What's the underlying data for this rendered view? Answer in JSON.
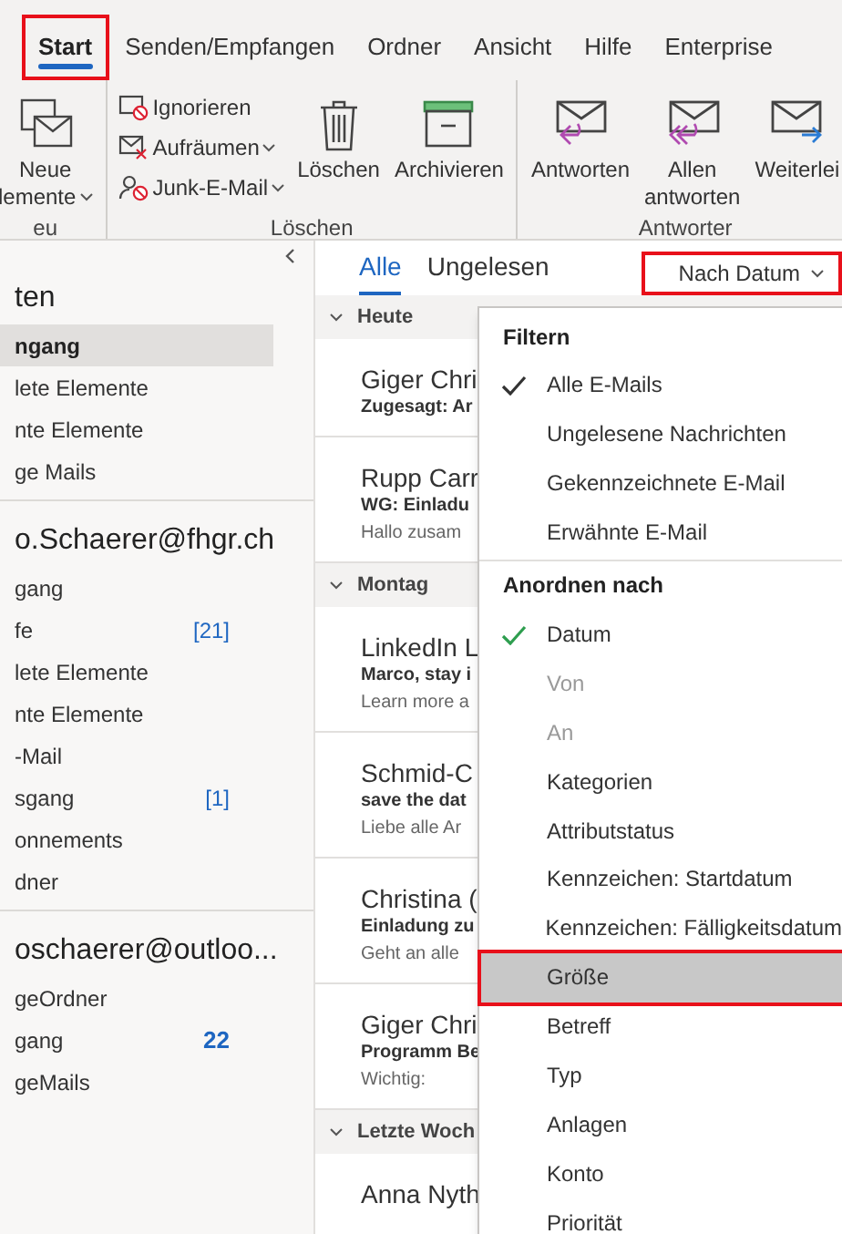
{
  "ribbon": {
    "tabs": [
      {
        "label": "Start",
        "selected": true,
        "annotated": true
      },
      {
        "label": "Senden/Empfangen",
        "selected": false,
        "annotated": false
      },
      {
        "label": "Ordner",
        "selected": false,
        "annotated": false
      },
      {
        "label": "Ansicht",
        "selected": false,
        "annotated": false
      },
      {
        "label": "Hilfe",
        "selected": false,
        "annotated": false
      },
      {
        "label": "Enterprise",
        "selected": false,
        "annotated": false
      }
    ],
    "groups": [
      {
        "label": "eu",
        "buttons": [
          {
            "kind": "large",
            "lines": [
              "Neue",
              "lemente"
            ],
            "caret": true
          }
        ]
      },
      {
        "label": "Löschen",
        "buttons": [
          {
            "kind": "small",
            "lines": [
              "Ignorieren"
            ],
            "caret": false
          },
          {
            "kind": "small",
            "lines": [
              "Aufräumen"
            ],
            "caret": true
          },
          {
            "kind": "small",
            "lines": [
              "Junk-E-Mail"
            ],
            "caret": true
          },
          {
            "kind": "large",
            "lines": [
              "Löschen"
            ],
            "caret": false
          },
          {
            "kind": "large",
            "lines": [
              "Archivieren"
            ],
            "caret": false
          }
        ]
      },
      {
        "label": "Antworter",
        "buttons": [
          {
            "kind": "large",
            "lines": [
              "Antworten"
            ],
            "caret": false
          },
          {
            "kind": "large",
            "lines": [
              "Allen",
              "antworten"
            ],
            "caret": false
          },
          {
            "kind": "large",
            "lines": [
              "Weiterlei"
            ],
            "caret": false
          }
        ]
      }
    ]
  },
  "folder_pane": {
    "accounts": [
      {
        "name": "ten",
        "folders": [
          {
            "label": "ngang",
            "selected": true,
            "bold": true
          },
          {
            "label": "lete Elemente",
            "selected": false,
            "bold": false
          },
          {
            "label": "nte Elemente",
            "selected": false,
            "bold": false
          },
          {
            "label": "ge Mails",
            "selected": false,
            "bold": false
          }
        ]
      },
      {
        "name": "o.Schaerer@fhgr.ch",
        "folders": [
          {
            "label": "gang",
            "selected": false,
            "bold": false
          },
          {
            "label": "fe",
            "count": "[21]",
            "selected": false,
            "bold": false,
            "count_bold": false
          },
          {
            "label": "lete Elemente",
            "selected": false,
            "bold": false
          },
          {
            "label": "nte Elemente",
            "selected": false,
            "bold": false
          },
          {
            "label": "-Mail",
            "selected": false,
            "bold": false
          },
          {
            "label": "sgang",
            "count": "[1]",
            "selected": false,
            "bold": false,
            "count_bold": false
          },
          {
            "label": "onnements",
            "selected": false,
            "bold": false
          },
          {
            "label": "dner",
            "selected": false,
            "bold": false
          }
        ]
      },
      {
        "name": "oschaerer@outloo...",
        "folders": [
          {
            "label": "geOrdner",
            "selected": false,
            "bold": false
          },
          {
            "label": "gang",
            "count": "22",
            "selected": false,
            "bold": false,
            "count_bold": true
          },
          {
            "label": "geMails",
            "selected": false,
            "bold": false
          }
        ]
      }
    ]
  },
  "message_list": {
    "tabs": [
      {
        "label": "Alle",
        "selected": true
      },
      {
        "label": "Ungelesen",
        "selected": false
      }
    ],
    "sort_button": {
      "label": "Nach Datum",
      "annotated": true
    },
    "groups": [
      {
        "title": "Heute",
        "messages": [
          {
            "sender": "Giger Chri",
            "subject": "Zugesagt: Ar"
          },
          {
            "sender": "Rupp Carr",
            "subject": "WG: Einladu",
            "preview": "Hallo zusam"
          }
        ]
      },
      {
        "title": "Montag",
        "messages": [
          {
            "sender": "LinkedIn L",
            "subject": "Marco, stay i",
            "preview": "Learn more a"
          },
          {
            "sender": "Schmid-C",
            "subject": "save the dat",
            "preview": "Liebe alle  Ar"
          },
          {
            "sender": "Christina (",
            "subject": "Einladung zu",
            "preview": "Geht an alle"
          },
          {
            "sender": "Giger Chri",
            "subject": "Programm Be",
            "preview": "Wichtig:"
          }
        ]
      },
      {
        "title": "Letzte Woch",
        "messages": [
          {
            "sender": "Anna Nyth"
          }
        ]
      }
    ]
  },
  "sort_menu": {
    "sections": [
      {
        "title": "Filtern",
        "items": [
          {
            "label": "Alle E-Mails",
            "checked": true,
            "color": "#333333",
            "selected": false,
            "disabled": false,
            "annotated": false
          },
          {
            "label": "Ungelesene Nachrichten",
            "checked": false,
            "selected": false,
            "disabled": false,
            "annotated": false
          },
          {
            "label": "Gekennzeichnete E-Mail",
            "checked": false,
            "selected": false,
            "disabled": false,
            "annotated": false
          },
          {
            "label": "Erwähnte E-Mail",
            "checked": false,
            "selected": false,
            "disabled": false,
            "annotated": false
          }
        ]
      },
      {
        "title": "Anordnen nach",
        "items": [
          {
            "label": "Datum",
            "checked": true,
            "color": "#2e9e4f",
            "selected": false,
            "disabled": false,
            "annotated": false
          },
          {
            "label": "Von",
            "checked": false,
            "selected": false,
            "disabled": true,
            "annotated": false
          },
          {
            "label": "An",
            "checked": false,
            "selected": false,
            "disabled": true,
            "annotated": false
          },
          {
            "label": "Kategorien",
            "checked": false,
            "selected": false,
            "disabled": false,
            "annotated": false
          },
          {
            "label": "Attributstatus",
            "checked": false,
            "selected": false,
            "disabled": false,
            "annotated": false
          },
          {
            "label": "Kennzeichen: Startdatum",
            "checked": false,
            "selected": false,
            "disabled": false,
            "annotated": false
          },
          {
            "label": "Kennzeichen: Fälligkeitsdatum",
            "checked": false,
            "selected": false,
            "disabled": false,
            "annotated": false
          },
          {
            "label": "Größe",
            "checked": false,
            "selected": true,
            "disabled": false,
            "annotated": true
          },
          {
            "label": "Betreff",
            "checked": false,
            "selected": false,
            "disabled": false,
            "annotated": false
          },
          {
            "label": "Typ",
            "checked": false,
            "selected": false,
            "disabled": false,
            "annotated": false
          },
          {
            "label": "Anlagen",
            "checked": false,
            "selected": false,
            "disabled": false,
            "annotated": false
          },
          {
            "label": "Konto",
            "checked": false,
            "selected": false,
            "disabled": false,
            "annotated": false
          },
          {
            "label": "Priorität",
            "checked": false,
            "selected": false,
            "disabled": false,
            "annotated": false
          }
        ]
      }
    ]
  }
}
